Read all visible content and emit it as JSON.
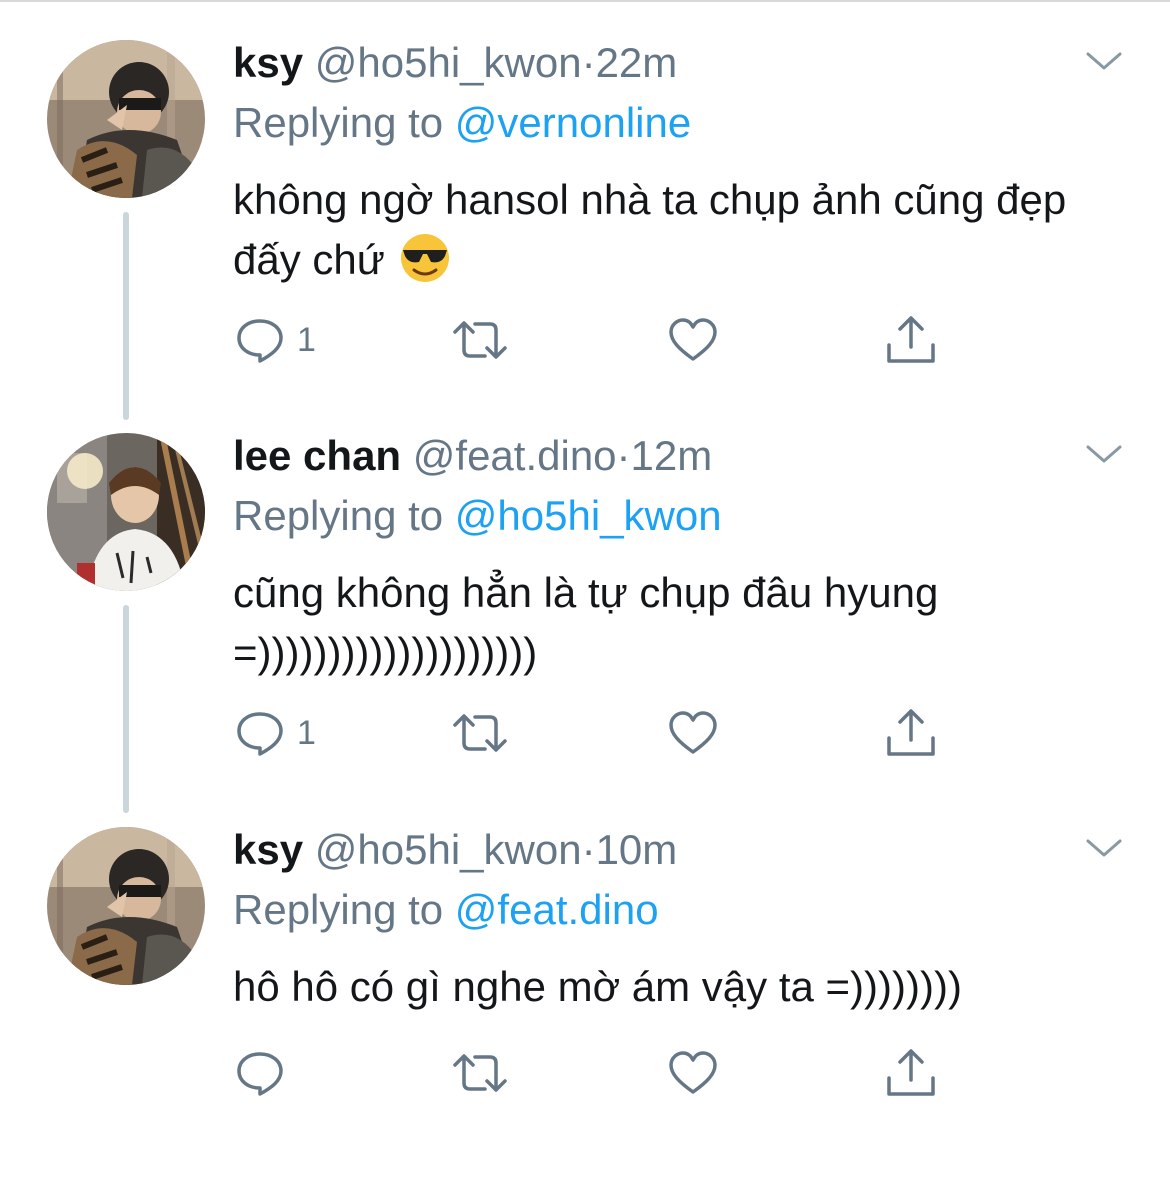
{
  "tweets": [
    {
      "name": "ksy",
      "handle": "@ho5hi_kwon",
      "separator": "·",
      "time": "22m",
      "reply_prefix": "Replying to",
      "reply_to": "@vernonline",
      "text": "không ngờ hansol nhà ta chụp ảnh cũng đẹp đấy chứ",
      "emoji": "smiling-face-with-sunglasses",
      "reply_count": "1",
      "retweet_count": "",
      "like_count": ""
    },
    {
      "name": "lee chan",
      "handle": "@feat.dino",
      "separator": "·",
      "time": "12m",
      "reply_prefix": "Replying to",
      "reply_to": "@ho5hi_kwon",
      "text": "cũng không hẳn là tự chụp đâu hyung =))))))))))))))))))))",
      "reply_count": "1",
      "retweet_count": "",
      "like_count": ""
    },
    {
      "name": "ksy",
      "handle": "@ho5hi_kwon",
      "separator": "·",
      "time": "10m",
      "reply_prefix": "Replying to",
      "reply_to": "@feat.dino",
      "text": "hô hô có gì nghe mờ ám vậy ta =))))))))",
      "reply_count": "",
      "retweet_count": "",
      "like_count": ""
    }
  ],
  "icons": {
    "caret": "chevron-down-icon",
    "reply": "reply-icon",
    "retweet": "retweet-icon",
    "like": "heart-icon",
    "share": "share-icon"
  },
  "colors": {
    "text": "#14171a",
    "secondary": "#657786",
    "link": "#1da1f2",
    "thread_line": "#cbd5dc",
    "icon": "#657786"
  }
}
